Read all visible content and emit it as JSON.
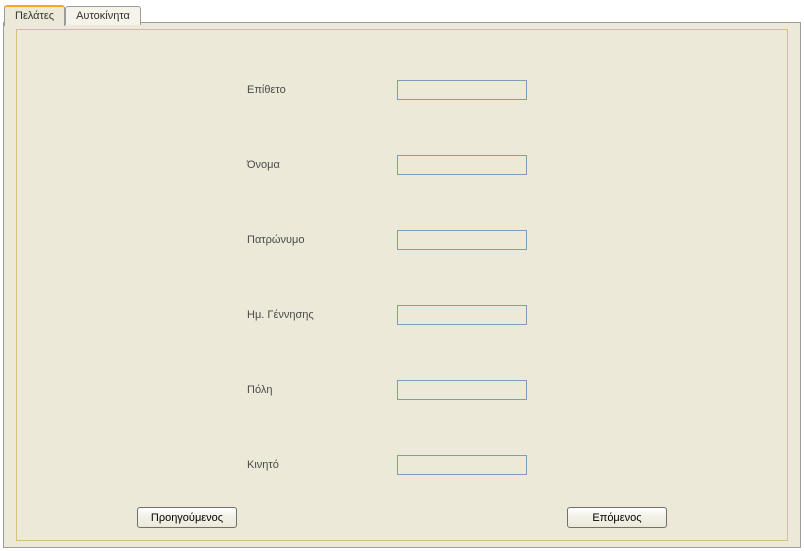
{
  "tabs": {
    "customers": "Πελάτες",
    "cars": "Αυτοκίνητα"
  },
  "form": {
    "surname": {
      "label": "Επίθετο",
      "value": ""
    },
    "name": {
      "label": "Όνομα",
      "value": ""
    },
    "fathersname": {
      "label": "Πατρώνυμο",
      "value": ""
    },
    "birthdate": {
      "label": "Ημ. Γέννησης",
      "value": ""
    },
    "city": {
      "label": "Πόλη",
      "value": ""
    },
    "mobile": {
      "label": "Κινητό",
      "value": ""
    }
  },
  "buttons": {
    "previous": "Προηγούμενος",
    "next": "Επόμενος"
  }
}
